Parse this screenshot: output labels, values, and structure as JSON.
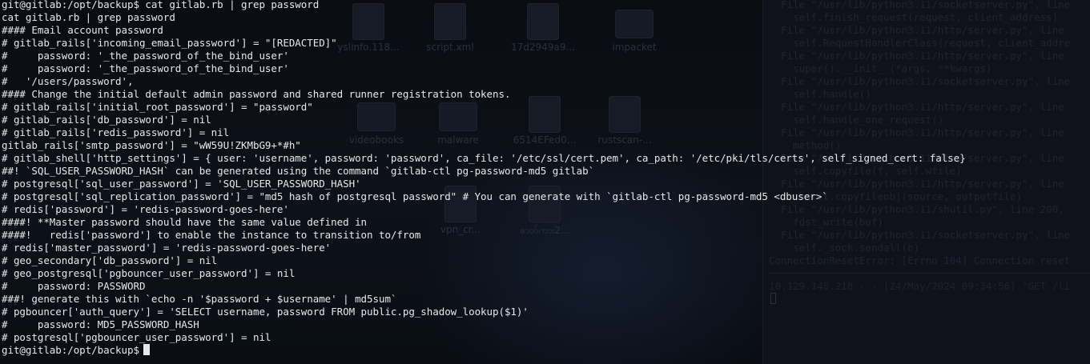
{
  "terminal": {
    "prompt": "git@gitlab:/opt/backup$",
    "lines": [
      "git@gitlab:/opt/backup$ cat gitlab.rb | grep password",
      "cat gitlab.rb | grep password",
      "#### Email account password",
      "# gitlab_rails['incoming_email_password'] = \"[REDACTED]\"",
      "#     password: '_the_password_of_the_bind_user'",
      "#     password: '_the_password_of_the_bind_user'",
      "#   '/users/password',",
      "#### Change the initial default admin password and shared runner registration tokens.",
      "# gitlab_rails['initial_root_password'] = \"password\"",
      "# gitlab_rails['db_password'] = nil",
      "# gitlab_rails['redis_password'] = nil",
      "gitlab_rails['smtp_password'] = \"wW59U!ZKMbG9+*#h\"",
      "# gitlab_shell['http_settings'] = { user: 'username', password: 'password', ca_file: '/etc/ssl/cert.pem', ca_path: '/etc/pki/tls/certs', self_signed_cert: false}",
      "##! `SQL_USER_PASSWORD_HASH` can be generated using the command `gitlab-ctl pg-password-md5 gitlab`",
      "# postgresql['sql_user_password'] = 'SQL_USER_PASSWORD_HASH'",
      "# postgresql['sql_replication_password'] = \"md5 hash of postgresql password\" # You can generate with `gitlab-ctl pg-password-md5 <dbuser>`",
      "# redis['password'] = 'redis-password-goes-here'",
      "####! **Master password should have the same value defined in",
      "####!   redis['password'] to enable the instance to transition to/from",
      "# redis['master_password'] = 'redis-password-goes-here'",
      "# geo_secondary['db_password'] = nil",
      "# geo_postgresql['pgbouncer_user_password'] = nil",
      "#     password: PASSWORD",
      "###! generate this with `echo -n '$password + $username' | md5sum`",
      "# pgbouncer['auth_query'] = 'SELECT username, password FROM public.pg_shadow_lookup($1)'",
      "#     password: MD5_PASSWORD_HASH",
      "# postgresql['pgbouncer_user_password'] = nil"
    ]
  },
  "desktop_icons": [
    "yslinfo.118...",
    "script.xml",
    "17d2949a9...",
    "impacket",
    "videobooks",
    "malware",
    "6514EFed0...",
    "rustscan-...",
    "vpn_cr...",
    "ဇာတ်ကား2..."
  ],
  "right_pane": {
    "lines": [
      "  File \"/usr/lib/python3.11/socketserver.py\", line",
      "    self.finish_request(request, client_address)",
      "  File \"/usr/lib/python3.11/http/server.py\", line",
      "    self.RequestHandlerClass(request, client_addre",
      "  File \"/usr/lib/python3.11/http/server.py\", line",
      "    super().__init__(*args, **kwargs)",
      "  File \"/usr/lib/python3.11/socketserver.py\", line",
      "    self.handle()",
      "  File \"/usr/lib/python3.11/http/server.py\", line",
      "    self.handle_one_request()",
      "  File \"/usr/lib/python3.11/http/server.py\", line",
      "    method()",
      "  File \"/usr/lib/python3.11/http/server.py\", line",
      "    self.copyfile(f, self.wfile)",
      "  File \"/usr/lib/python3.11/http/server.py\", line",
      "    shutil.copyfileobj(source, outputfile)",
      "  File \"/usr/lib/python3.11/shutil.py\", line 200,",
      "    fdst_write(buf)",
      "  File \"/usr/lib/python3.11/socketserver.py\", line",
      "    self._sock.sendall(b)",
      "ConnectionResetError: [Errno 104] Connection reset",
      "10.129.148.218 - - [24/May/2024 09:34:56] \"GET /li"
    ]
  },
  "colors": {
    "text": "#e8e8ea",
    "background": "#0b0d13"
  }
}
